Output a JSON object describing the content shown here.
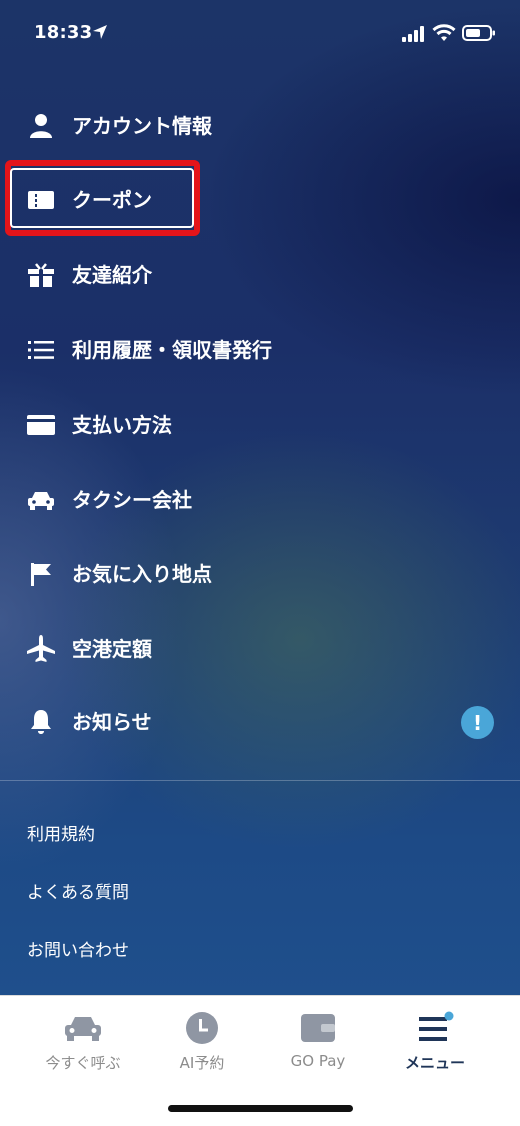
{
  "status_bar": {
    "time": "18:33"
  },
  "menu": [
    {
      "label": "アカウント情報",
      "icon": "person-icon"
    },
    {
      "label": "クーポン",
      "icon": "ticket-icon"
    },
    {
      "label": "友達紹介",
      "icon": "gift-icon"
    },
    {
      "label": "利用履歴・領収書発行",
      "icon": "list-icon"
    },
    {
      "label": "支払い方法",
      "icon": "card-icon"
    },
    {
      "label": "タクシー会社",
      "icon": "taxi-icon"
    },
    {
      "label": "お気に入り地点",
      "icon": "flag-icon"
    },
    {
      "label": "空港定額",
      "icon": "airplane-icon"
    },
    {
      "label": "お知らせ",
      "icon": "bell-icon"
    }
  ],
  "notice_badge": "!",
  "links": [
    {
      "label": "利用規約"
    },
    {
      "label": "よくある質問"
    },
    {
      "label": "お問い合わせ"
    }
  ],
  "tabs": [
    {
      "label": "今すぐ呼ぶ",
      "icon": "car-icon"
    },
    {
      "label": "AI予約",
      "icon": "clock-icon"
    },
    {
      "label": "GO Pay",
      "icon": "wallet-icon"
    },
    {
      "label": "メニュー",
      "icon": "menu-icon",
      "active": true
    }
  ],
  "colors": {
    "highlight": "#e4141a",
    "badge": "#4aa6d8",
    "active_tab": "#1f3558"
  }
}
